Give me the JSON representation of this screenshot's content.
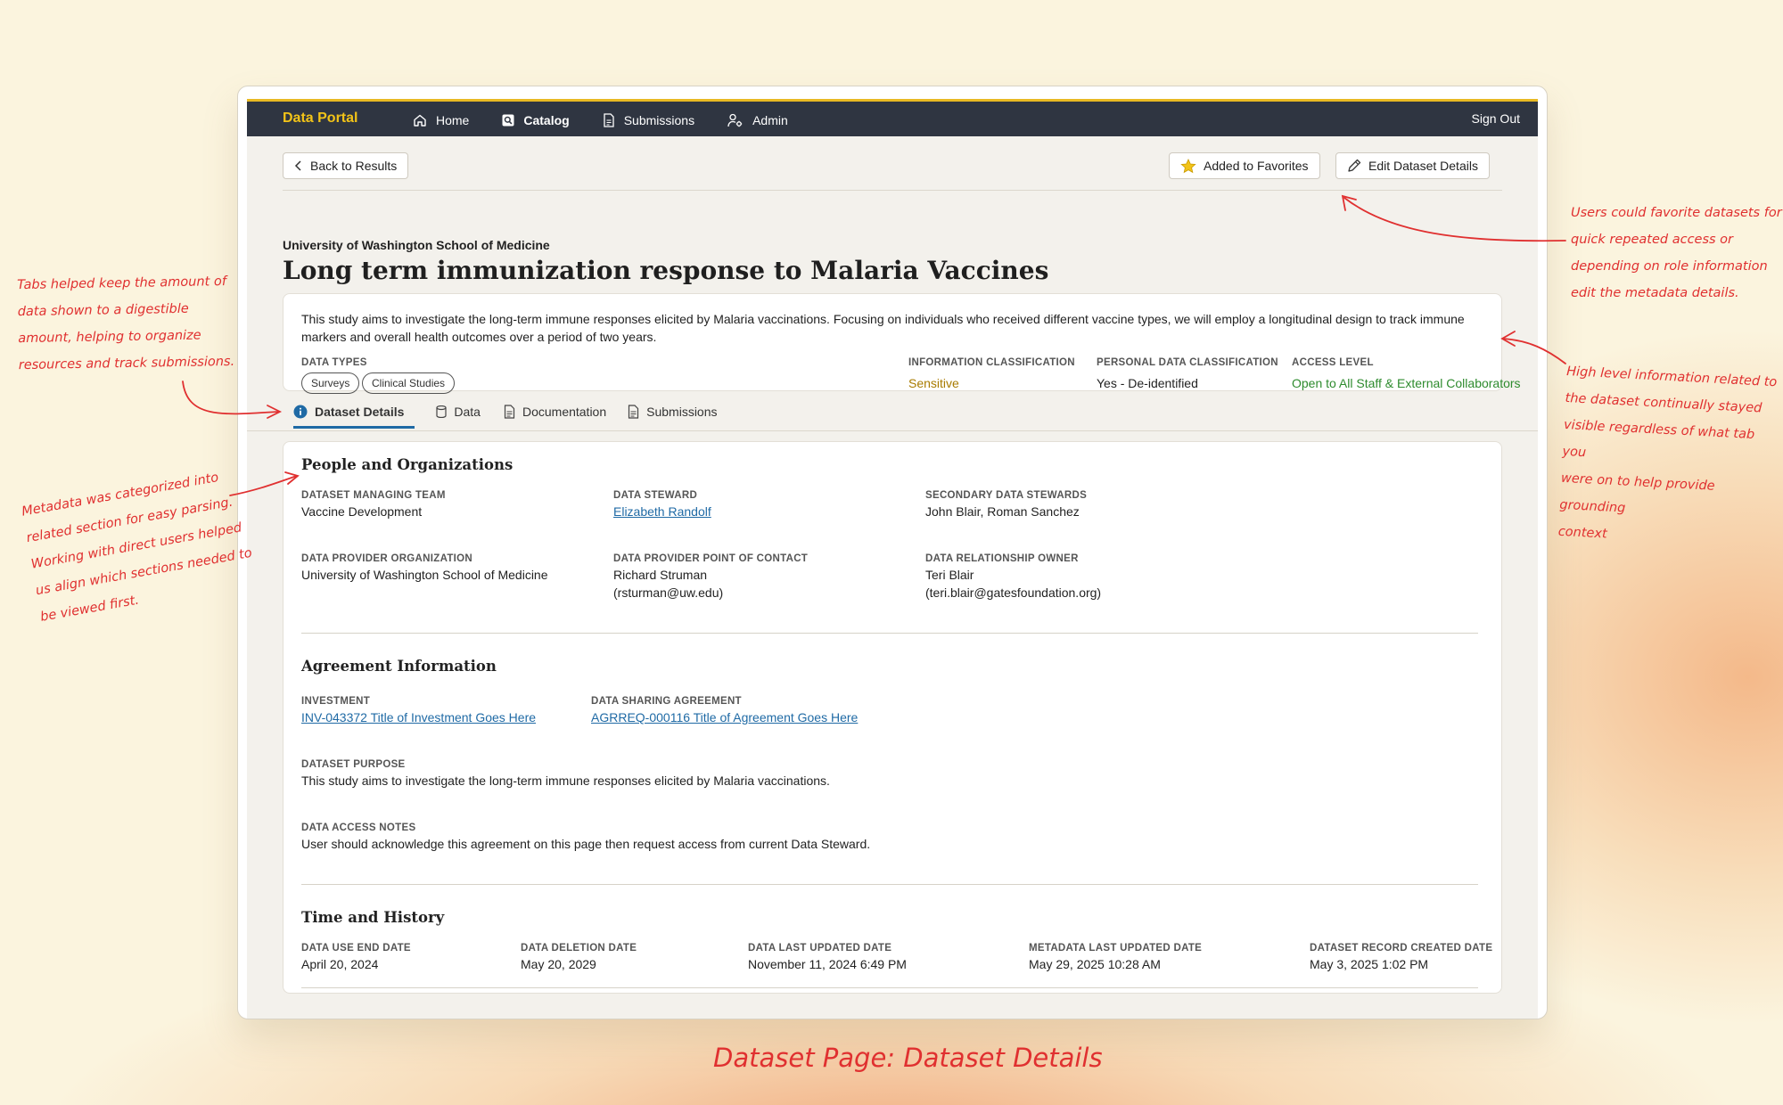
{
  "app": {
    "brand": "Data Portal",
    "nav": [
      {
        "label": "Home",
        "icon": "home-icon"
      },
      {
        "label": "Catalog",
        "icon": "search-icon",
        "active": true
      },
      {
        "label": "Submissions",
        "icon": "document-icon"
      },
      {
        "label": "Admin",
        "icon": "user-gear-icon"
      }
    ],
    "sign_out": "Sign Out"
  },
  "toolbar": {
    "back": "Back to Results",
    "favorite": "Added to Favorites",
    "edit": "Edit Dataset Details"
  },
  "dataset": {
    "organization": "University of Washington School of Medicine",
    "title": "Long term immunization response to Malaria Vaccines",
    "description": "This study aims to investigate the long-term immune responses elicited by Malaria vaccinations. Focusing on individuals who received different vaccine types, we will employ a longitudinal design to track immune markers and overall health outcomes over a period of two years.",
    "data_types_label": "DATA TYPES",
    "data_types": [
      "Surveys",
      "Clinical Studies"
    ],
    "info_class_label": "INFORMATION CLASSIFICATION",
    "info_class": "Sensitive",
    "personal_class_label": "PERSONAL DATA CLASSIFICATION",
    "personal_class": "Yes - De-identified",
    "access_label": "ACCESS LEVEL",
    "access": "Open to All Staff & External Collaborators"
  },
  "tabs": [
    "Dataset Details",
    "Data",
    "Documentation",
    "Submissions"
  ],
  "people": {
    "heading": "People and Organizations",
    "managing_team_label": "DATASET MANAGING TEAM",
    "managing_team": "Vaccine Development",
    "steward_label": "DATA STEWARD",
    "steward": "Elizabeth Randolf",
    "secondary_label": "SECONDARY DATA STEWARDS",
    "secondary": "John Blair, Roman Sanchez",
    "provider_org_label": "DATA PROVIDER ORGANIZATION",
    "provider_org": "University of Washington School of Medicine",
    "poc_label": "DATA PROVIDER POINT OF CONTACT",
    "poc_name": "Richard Struman",
    "poc_email": "(rsturman@uw.edu)",
    "rel_owner_label": "DATA RELATIONSHIP OWNER",
    "rel_owner_name": "Teri Blair",
    "rel_owner_email": "(teri.blair@gatesfoundation.org)"
  },
  "agreement": {
    "heading": "Agreement Information",
    "investment_label": "INVESTMENT",
    "investment": "INV-043372 Title of Investment Goes Here",
    "dsa_label": "DATA SHARING AGREEMENT",
    "dsa": "AGRREQ-000116 Title of Agreement Goes Here",
    "purpose_label": "DATASET PURPOSE",
    "purpose": "This study aims to investigate the long-term immune responses elicited by Malaria vaccinations.",
    "notes_label": "DATA ACCESS NOTES",
    "notes": "User should acknowledge this agreement on this page then request access from current Data Steward."
  },
  "history": {
    "heading": "Time and History",
    "items": [
      {
        "label": "DATA USE END DATE",
        "value": "April 20, 2024"
      },
      {
        "label": "DATA DELETION DATE",
        "value": "May 20, 2029"
      },
      {
        "label": "DATA LAST UPDATED DATE",
        "value": "November 11, 2024 6:49 PM"
      },
      {
        "label": "METADATA LAST UPDATED DATE",
        "value": "May 29, 2025 10:28 AM"
      },
      {
        "label": "DATASET RECORD CREATED DATE",
        "value": "May 3, 2025 1:02 PM"
      }
    ]
  },
  "annotations": {
    "tabs_note": [
      "Tabs helped keep the amount of",
      "data shown to a digestible",
      "amount, helping to organize",
      "resources and track submissions."
    ],
    "metadata_note": [
      "Metadata was categorized into",
      "related section for easy parsing.",
      "Working with direct users helped",
      "us align which sections needed to",
      "be viewed first."
    ],
    "favorite_note": [
      "Users could favorite datasets for",
      "quick repeated access or",
      "depending on role information",
      "edit the metadata details."
    ],
    "highlevel_note": [
      "High level information related to",
      "the dataset continually stayed",
      "visible regardless of what tab you",
      "were on to help provide grounding",
      "context"
    ]
  },
  "caption": "Dataset Page: Dataset Details",
  "colors": {
    "accent": "#e8b923",
    "link": "#1f6aa5",
    "sensitive": "#a87b00",
    "access_open": "#2e8b2e",
    "annotation": "#e03030"
  }
}
